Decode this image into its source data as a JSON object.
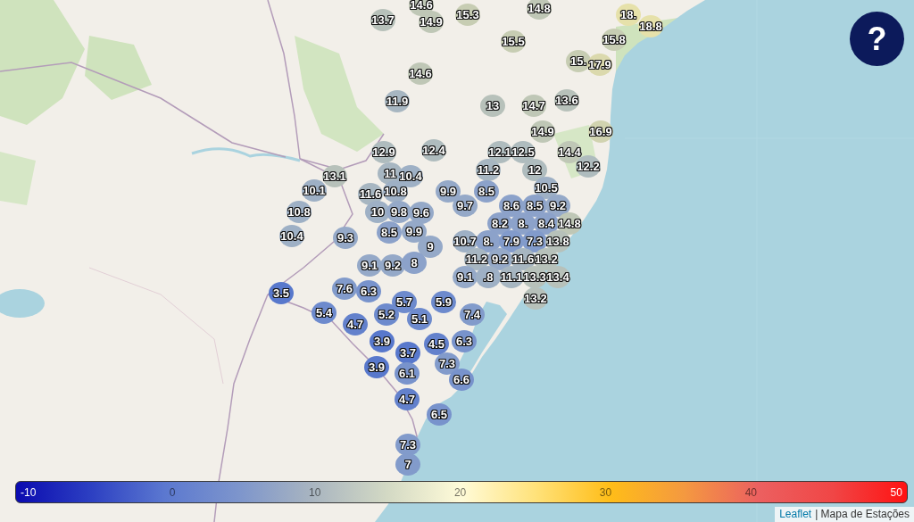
{
  "markers": [
    {
      "value": "14.6",
      "color": "#bfc7b6"
    },
    {
      "value": "14.8",
      "color": "#bfc7b6"
    },
    {
      "value": "13.7",
      "color": "#b7c1ba"
    },
    {
      "value": "14.9",
      "color": "#bfc7b6"
    },
    {
      "value": "15.3",
      "color": "#c7cdb3"
    },
    {
      "value": "18.",
      "color": "#e6e1aa"
    },
    {
      "value": "18.8",
      "color": "#e6e1aa"
    },
    {
      "value": "15.5",
      "color": "#c7cdb3"
    },
    {
      "value": "15.8",
      "color": "#c7cdb3"
    },
    {
      "value": "15.",
      "color": "#c7cdb3"
    },
    {
      "value": "17.9",
      "color": "#dbd9ad"
    },
    {
      "value": "14.6",
      "color": "#bfc7b6"
    },
    {
      "value": "11.9",
      "color": "#a7b6c1"
    },
    {
      "value": "13",
      "color": "#b7c1ba"
    },
    {
      "value": "14.7",
      "color": "#bfc7b6"
    },
    {
      "value": "13.6",
      "color": "#b7c1ba"
    },
    {
      "value": "14.9",
      "color": "#bfc7b6"
    },
    {
      "value": "16.9",
      "color": "#d1d3b0"
    },
    {
      "value": "12.9",
      "color": "#afbcbe"
    },
    {
      "value": "12.4",
      "color": "#afbcbe"
    },
    {
      "value": "12.1",
      "color": "#afbcbe"
    },
    {
      "value": "12.5",
      "color": "#afbcbe"
    },
    {
      "value": "14.4",
      "color": "#bfc7b6"
    },
    {
      "value": "13.1",
      "color": "#b7c1ba"
    },
    {
      "value": "11",
      "color": "#a7b6c1"
    },
    {
      "value": "10.4",
      "color": "#9eb0c5"
    },
    {
      "value": "11.2",
      "color": "#a7b6c1"
    },
    {
      "value": "12",
      "color": "#afbcbe"
    },
    {
      "value": "12.2",
      "color": "#afbcbe"
    },
    {
      "value": "10.1",
      "color": "#9eb0c5"
    },
    {
      "value": "11.6",
      "color": "#a7b6c1"
    },
    {
      "value": "10.8",
      "color": "#9eb0c5"
    },
    {
      "value": "9.9",
      "color": "#95a9c8"
    },
    {
      "value": "8.5",
      "color": "#8ca2ca"
    },
    {
      "value": "10.5",
      "color": "#9eb0c5"
    },
    {
      "value": "10.8",
      "color": "#9eb0c5"
    },
    {
      "value": "10",
      "color": "#9eb0c5"
    },
    {
      "value": "9.8",
      "color": "#95a9c8"
    },
    {
      "value": "9.6",
      "color": "#95a9c8"
    },
    {
      "value": "9.7",
      "color": "#95a9c8"
    },
    {
      "value": "8.6",
      "color": "#8ca2ca"
    },
    {
      "value": "8.5",
      "color": "#8ca2ca"
    },
    {
      "value": "9.2",
      "color": "#95a9c8"
    },
    {
      "value": "8.2",
      "color": "#8ca2ca"
    },
    {
      "value": "8.",
      "color": "#8ca2ca"
    },
    {
      "value": "8.4",
      "color": "#8ca2ca"
    },
    {
      "value": "14.8",
      "color": "#bfc7b6"
    },
    {
      "value": "10.4",
      "color": "#9eb0c5"
    },
    {
      "value": "9.3",
      "color": "#95a9c8"
    },
    {
      "value": "8.5",
      "color": "#8ca2ca"
    },
    {
      "value": "9.9",
      "color": "#95a9c8"
    },
    {
      "value": "9",
      "color": "#95a9c8"
    },
    {
      "value": "10.7",
      "color": "#9eb0c5"
    },
    {
      "value": "8.",
      "color": "#8ca2ca"
    },
    {
      "value": "7.9",
      "color": "#829bcb"
    },
    {
      "value": "7.3",
      "color": "#829bcb"
    },
    {
      "value": "13.8",
      "color": "#b7c1ba"
    },
    {
      "value": "9.1",
      "color": "#95a9c8"
    },
    {
      "value": "9.2",
      "color": "#95a9c8"
    },
    {
      "value": "8",
      "color": "#8ca2ca"
    },
    {
      "value": "11.2",
      "color": "#a7b6c1"
    },
    {
      "value": "9.2",
      "color": "#95a9c8"
    },
    {
      "value": "11.6",
      "color": "#a7b6c1"
    },
    {
      "value": "13.2",
      "color": "#b7c1ba"
    },
    {
      "value": "9.1",
      "color": "#95a9c8"
    },
    {
      "value": ".8",
      "color": "#9eb0c5"
    },
    {
      "value": "11.1",
      "color": "#a7b6c1"
    },
    {
      "value": "13.3",
      "color": "#b7c1ba"
    },
    {
      "value": "13.4",
      "color": "#b7c1ba"
    },
    {
      "value": "3.5",
      "color": "#5878cc"
    },
    {
      "value": "7.6",
      "color": "#829bcb"
    },
    {
      "value": "6.3",
      "color": "#7893cc"
    },
    {
      "value": "5.7",
      "color": "#6d8acd"
    },
    {
      "value": "5.9",
      "color": "#6d8acd"
    },
    {
      "value": "13.2",
      "color": "#b7c1ba"
    },
    {
      "value": "5.4",
      "color": "#6d8acd"
    },
    {
      "value": "4.7",
      "color": "#6381cc"
    },
    {
      "value": "5.2",
      "color": "#6d8acd"
    },
    {
      "value": "5.1",
      "color": "#6d8acd"
    },
    {
      "value": "7.4",
      "color": "#829bcb"
    },
    {
      "value": "3.9",
      "color": "#5878cc"
    },
    {
      "value": "4.5",
      "color": "#6381cc"
    },
    {
      "value": "6.3",
      "color": "#7893cc"
    },
    {
      "value": "3.7",
      "color": "#5878cc"
    },
    {
      "value": "3.9",
      "color": "#5878cc"
    },
    {
      "value": "6.1",
      "color": "#7893cc"
    },
    {
      "value": "7.3",
      "color": "#829bcb"
    },
    {
      "value": "6.6",
      "color": "#7893cc"
    },
    {
      "value": "4.7",
      "color": "#6381cc"
    },
    {
      "value": "6.5",
      "color": "#7893cc"
    },
    {
      "value": "7.3",
      "color": "#829bcb"
    },
    {
      "value": "7",
      "color": "#829bcb"
    }
  ],
  "help_button": {
    "label": "?"
  },
  "legend": {
    "ticks": [
      "-10",
      "0",
      "10",
      "20",
      "30",
      "40",
      "50"
    ]
  },
  "attribution": {
    "link": "Leaflet",
    "text": "| Mapa de Estações"
  }
}
